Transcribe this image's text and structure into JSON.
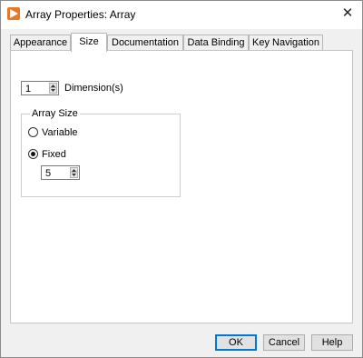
{
  "window": {
    "title": "Array Properties: Array",
    "close_glyph": "✕",
    "icon": "labview-play-icon",
    "icon_color": "#e8772a"
  },
  "tabs": [
    {
      "label": "Appearance",
      "active": false
    },
    {
      "label": "Size",
      "active": true
    },
    {
      "label": "Documentation",
      "active": false
    },
    {
      "label": "Data Binding",
      "active": false
    },
    {
      "label": "Key Navigation",
      "active": false
    }
  ],
  "size_tab": {
    "dimensions_value": "1",
    "dimensions_label": "Dimension(s)",
    "array_size": {
      "legend": "Array Size",
      "variable_label": "Variable",
      "variable_checked": false,
      "fixed_label": "Fixed",
      "fixed_checked": true,
      "fixed_value": "5"
    }
  },
  "buttons": {
    "ok": "OK",
    "cancel": "Cancel",
    "help": "Help"
  },
  "colors": {
    "default_button_border": "#0078d7"
  }
}
